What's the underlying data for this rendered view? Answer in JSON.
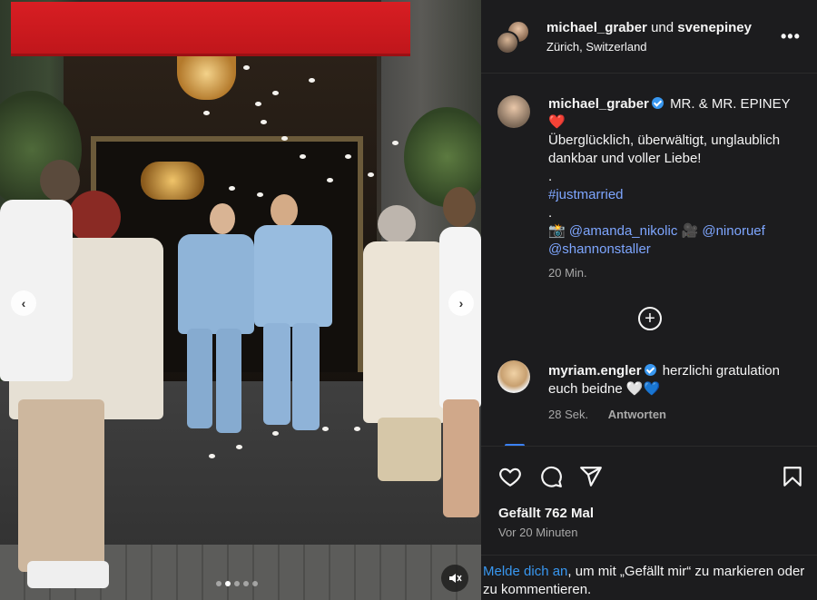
{
  "post": {
    "header": {
      "user1": "michael_graber",
      "joiner": "und",
      "user2": "svenepiney",
      "location": "Zürich, Switzerland",
      "more_icon": "more-horizontal-icon"
    },
    "caption": {
      "username": "michael_graber",
      "title": "MR. & MR. EPINEY",
      "heart": "❤️",
      "line1": "Überglücklich, überwältigt, unglaublich dankbar und voller Liebe!",
      "dot1": ".",
      "hashtag": "#justmarried",
      "dot2": ".",
      "camera_emoji": "📸",
      "credit1": "@amanda_nikolic",
      "video_emoji": "🎥",
      "credit2": "@ninoruef",
      "credit3": "@shannonstaller",
      "time": "20 Min."
    },
    "comment": {
      "username": "myriam.engler",
      "text": "herzlichi gratulation euch beidne 🤍💙",
      "time": "28 Sek.",
      "reply_label": "Antworten"
    },
    "actions": {
      "like_icon": "heart-icon",
      "comment_icon": "comment-icon",
      "share_icon": "send-icon",
      "save_icon": "bookmark-icon"
    },
    "likes": "Gefällt 762 Mal",
    "posted": "Vor 20 Minuten",
    "login": {
      "link": "Melde dich an",
      "rest": ", um mit „Gefällt mir“ zu markieren oder zu kommentieren."
    }
  },
  "carousel": {
    "slides": 5,
    "active_slide": 2,
    "mute_icon": "muted-speaker-icon"
  },
  "colors": {
    "panel_bg": "#1c1c1e",
    "link": "#3897f0",
    "mention": "#7ea6ff",
    "verified": "#3897f0",
    "awning": "#d81e23"
  }
}
